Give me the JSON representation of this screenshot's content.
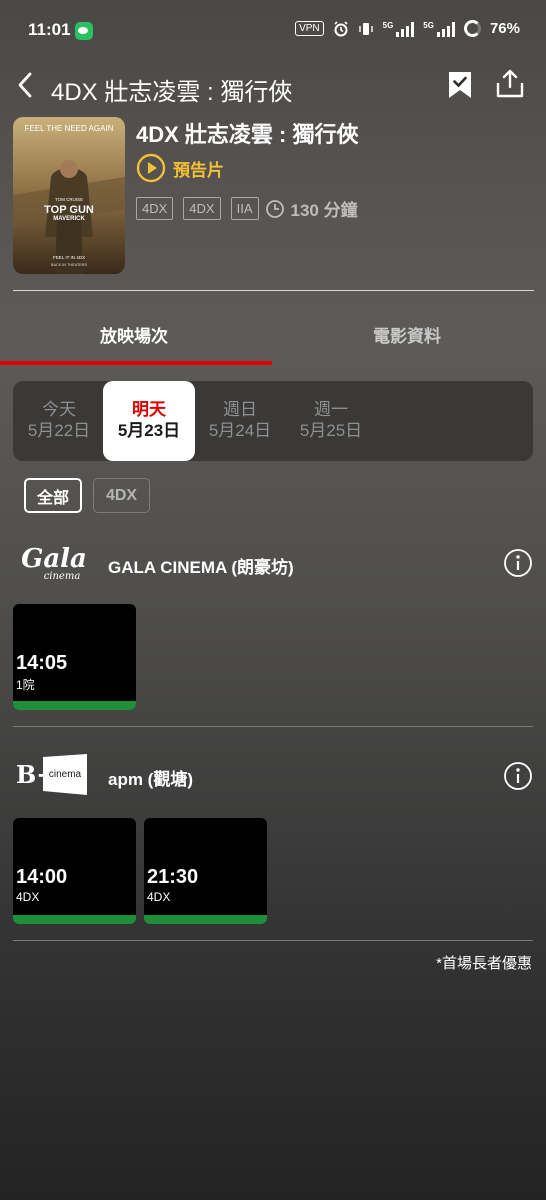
{
  "status_bar": {
    "time": "11:01",
    "vpn": "VPN",
    "net1": "5G",
    "net2": "5G",
    "battery": "76%"
  },
  "header": {
    "title": "4DX 壯志凌雲 : 獨行俠"
  },
  "movie": {
    "title": "4DX 壯志凌雲 : 獨行俠",
    "trailer_label": "預告片",
    "tags": [
      "4DX",
      "4DX",
      "IIA"
    ],
    "runtime": "130 分鐘",
    "poster_text": {
      "tagline": "FEEL THE NEED AGAIN",
      "actor": "TOM CRUISE",
      "logo1": "TOP GUN",
      "logo2": "MAVERICK",
      "format": "FEEL IT IN 4DX",
      "release": "BACK IN THEATERS"
    }
  },
  "tabs": [
    {
      "label": "放映場次",
      "active": true
    },
    {
      "label": "電影資料",
      "active": false
    }
  ],
  "dates": [
    {
      "day": "今天",
      "date": "5月22日",
      "active": false
    },
    {
      "day": "明天",
      "date": "5月23日",
      "active": true
    },
    {
      "day": "週日",
      "date": "5月24日",
      "active": false
    },
    {
      "day": "週一",
      "date": "5月25日",
      "active": false
    }
  ],
  "filters": [
    {
      "label": "全部",
      "active": true
    },
    {
      "label": "4DX",
      "active": false
    }
  ],
  "cinemas": [
    {
      "name": "GALA CINEMA (朗豪坊)",
      "logo_text": "Gala",
      "logo_sub": "cinema",
      "showtimes": [
        {
          "time": "14:05",
          "hall": "1院"
        }
      ]
    },
    {
      "name": "apm (觀塘)",
      "logo_text": "B+",
      "logo_sub": "cinema",
      "showtimes": [
        {
          "time": "14:00",
          "hall": "4DX"
        },
        {
          "time": "21:30",
          "hall": "4DX"
        }
      ]
    }
  ],
  "footnote": "*首場長者優惠",
  "colors": {
    "accent_red": "#e50000",
    "trailer_gold": "#f2c036",
    "seat_bar_green": "#1f8f3a"
  }
}
